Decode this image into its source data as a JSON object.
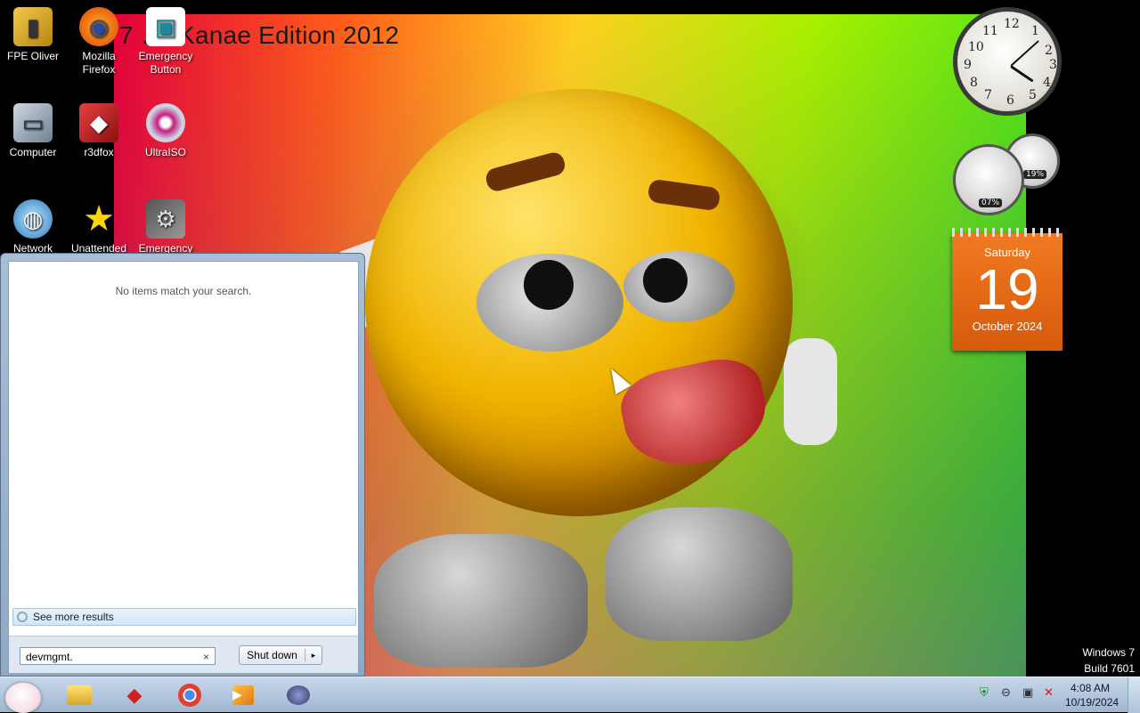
{
  "wallpaper": {
    "title": "7 …sKanae Edition 2012"
  },
  "desktop_icons": [
    {
      "label": "FPE Oliver",
      "icon": "folder-user-icon"
    },
    {
      "label": "Mozilla Firefox",
      "icon": "firefox-icon"
    },
    {
      "label": "Emergency Button",
      "icon": "emergency-button-icon"
    },
    {
      "label": "Computer",
      "icon": "computer-icon"
    },
    {
      "label": "r3dfox",
      "icon": "r3dfox-icon"
    },
    {
      "label": "UltraISO",
      "icon": "ultraiso-disc-icon"
    },
    {
      "label": "Network",
      "icon": "network-globe-icon"
    },
    {
      "label": "Unattended",
      "icon": "star-icon"
    },
    {
      "label": "Emergency",
      "icon": "emergency-tool-icon"
    }
  ],
  "gadgets": {
    "clock": {
      "hour": 4,
      "minute": 8,
      "numerals": [
        "12",
        "1",
        "2",
        "3",
        "4",
        "5",
        "6",
        "7",
        "8",
        "9",
        "10",
        "11"
      ]
    },
    "cpu_meter": {
      "cpu_pct": "07%",
      "mem_pct": "19%"
    },
    "calendar": {
      "weekday": "Saturday",
      "day": "19",
      "month_year": "October 2024"
    }
  },
  "start_menu": {
    "empty_message": "No items match your search.",
    "see_more": "See more results",
    "search_value": "devmgmt.",
    "clear_symbol": "×",
    "shutdown_label": "Shut down",
    "shutdown_arrow": "▸"
  },
  "watermark": {
    "line1": "Windows 7",
    "line2": "Build 7601"
  },
  "taskbar": {
    "pinned": [
      "explorer-folder-icon",
      "r3dfox-icon",
      "chrome-icon",
      "media-player-icon",
      "game-icon"
    ],
    "tray_icons": [
      "security-shield-icon",
      "minus-circle-icon",
      "network-icon",
      "volume-muted-icon"
    ],
    "time": "4:08 AM",
    "date": "10/19/2024"
  },
  "colors": {
    "calendar_orange": "#e8691a",
    "taskbar_blue": "#b4c8e0"
  }
}
